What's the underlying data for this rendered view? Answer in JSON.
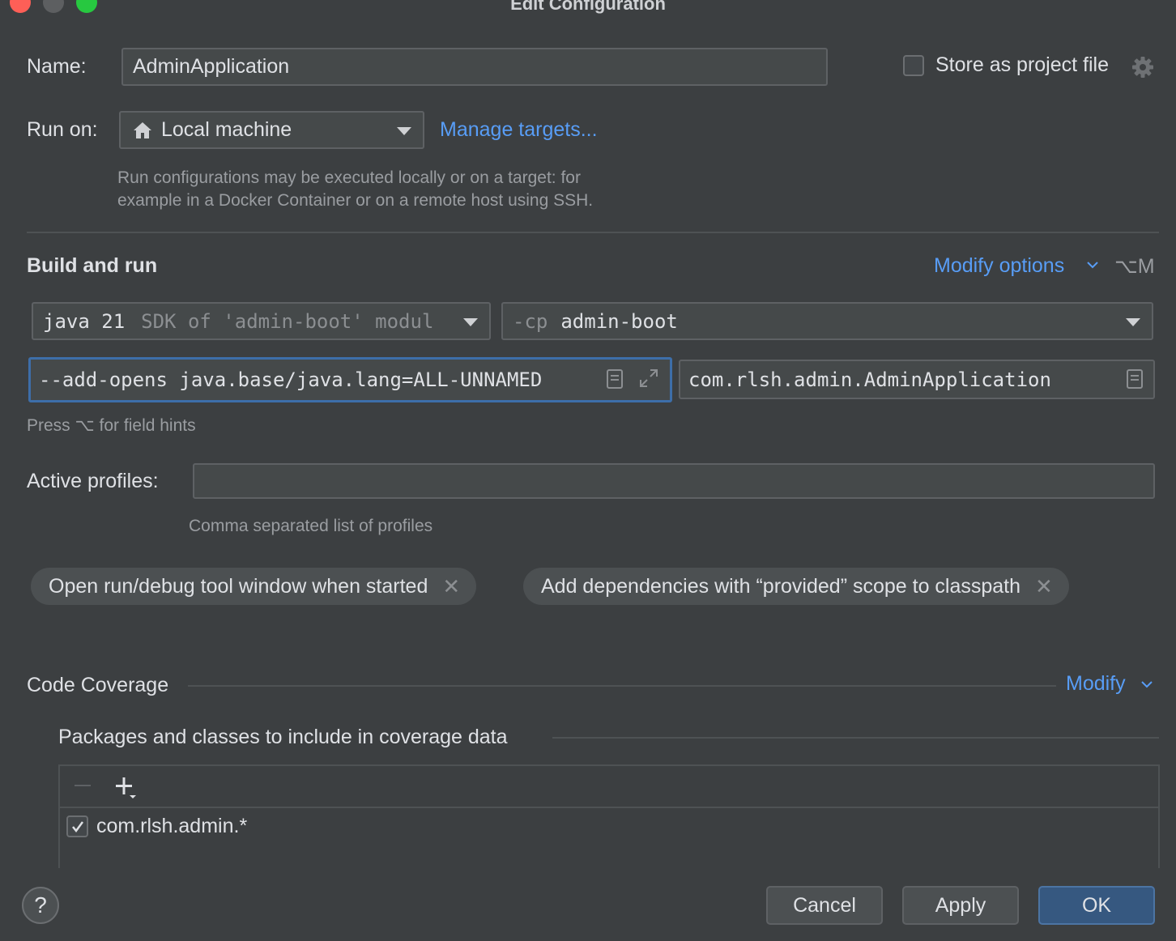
{
  "window": {
    "title": "Edit Configuration"
  },
  "name": {
    "label": "Name:",
    "value": "AdminApplication"
  },
  "store": {
    "label": "Store as project file",
    "checked": false
  },
  "run_on": {
    "label": "Run on:",
    "value": "Local machine",
    "manage_link": "Manage targets...",
    "hint_line1": "Run configurations may be executed locally or on a target: for",
    "hint_line2": "example in a Docker Container or on a remote host using SSH."
  },
  "build_and_run": {
    "title": "Build and run",
    "modify_options": "Modify options",
    "shortcut": "⌥M",
    "jdk_main": "java 21",
    "jdk_sub": "SDK of 'admin-boot' modul",
    "cp_prefix": "-cp",
    "cp_value": "admin-boot",
    "vm_options": "--add-opens java.base/java.lang=ALL-UNNAMED",
    "main_class": "com.rlsh.admin.AdminApplication",
    "field_hint": "Press ⌥ for field hints"
  },
  "profiles": {
    "label": "Active profiles:",
    "value": "",
    "hint": "Comma separated list of profiles"
  },
  "chips": [
    {
      "label": "Open run/debug tool window when started"
    },
    {
      "label": "Add dependencies with “provided” scope to classpath"
    }
  ],
  "coverage": {
    "title": "Code Coverage",
    "modify": "Modify",
    "packages_title": "Packages and classes to include in coverage data",
    "items": [
      {
        "label": "com.rlsh.admin.*",
        "checked": true
      }
    ]
  },
  "buttons": {
    "help": "?",
    "cancel": "Cancel",
    "apply": "Apply",
    "ok": "OK"
  },
  "colors": {
    "background": "#3c3f41",
    "link": "#589df6",
    "focus_border": "#3d6ea9",
    "ok_button": "#365880"
  },
  "icons": {
    "home": "home-icon",
    "gear": "gear-icon",
    "clipboard": "clipboard-icon",
    "expand": "expand-icon",
    "chevron": "chevron-down-icon"
  }
}
